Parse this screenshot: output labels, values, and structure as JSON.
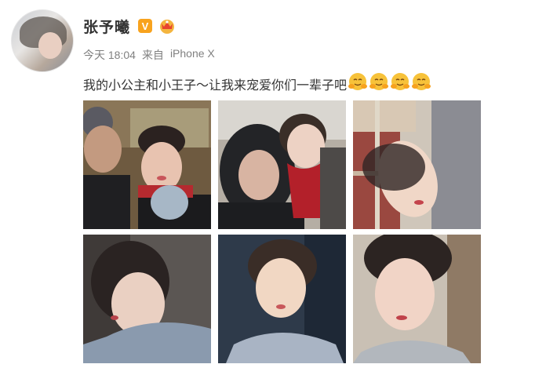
{
  "user": {
    "name": "张予曦",
    "verified_badge": "V",
    "badge_icon": "crown-icon",
    "avatar_icon": "avatar"
  },
  "meta": {
    "time": "今天 18:04",
    "source_prefix": "来自",
    "device": "iPhone X"
  },
  "post": {
    "text": "我的小公主和小王子～让我来宠爱你们一辈子吧",
    "emoji_count": 4,
    "emoji_name": "hug-emoji"
  },
  "colors": {
    "username": "#333333",
    "meta": "#808080",
    "badge": "#f8a31e"
  },
  "photos": [
    {
      "name": "photo-1",
      "subject": "selfie with man in beanie"
    },
    {
      "name": "photo-2",
      "subject": "two women, red scarf"
    },
    {
      "name": "photo-3",
      "subject": "woman lying on plaid blanket"
    },
    {
      "name": "photo-4",
      "subject": "side profile, blue sweater"
    },
    {
      "name": "photo-5",
      "subject": "eyes closed in sunlight"
    },
    {
      "name": "photo-6",
      "subject": "close-up portrait"
    }
  ]
}
